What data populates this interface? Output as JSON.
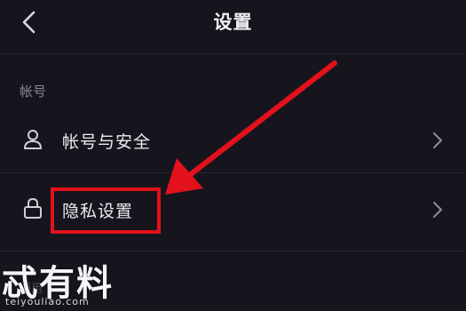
{
  "header": {
    "title": "设置"
  },
  "section": {
    "label": "帐号"
  },
  "items": [
    {
      "label": "帐号与安全",
      "icon": "person-icon"
    },
    {
      "label": "隐私设置",
      "icon": "lock-icon"
    }
  ],
  "partial_text": "通用",
  "annotation": {
    "color": "#e2111b"
  },
  "watermark": {
    "name": "忒有料",
    "url": "teiyouliao.com"
  }
}
